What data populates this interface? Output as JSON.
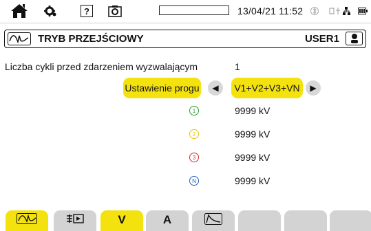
{
  "topbar": {
    "icons": [
      "home-icon",
      "settings-gear-icon",
      "help-icon",
      "camera-icon",
      "bluetooth-icon",
      "usb-network-icon",
      "battery-icon"
    ],
    "help_glyph": "?",
    "progress_fraction": 0.0,
    "datetime": "13/04/21 11:52"
  },
  "title": {
    "text": "TRYB PRZEJŚCIOWY",
    "user": "USER1",
    "icon": "transient-wave-icon"
  },
  "settings": {
    "cycles_label": "Liczba cykli przed zdarzeniem wyzwalającym",
    "cycles_value": "1",
    "threshold_button": "Ustawienie progu",
    "channel_selector": "V1+V2+V3+VN",
    "left_arrow": "◀",
    "right_arrow": "▶"
  },
  "thresholds": [
    {
      "phase": "1",
      "color": "#2a9d2a",
      "value": "9999 kV"
    },
    {
      "phase": "2",
      "color": "#e8c400",
      "value": "9999 kV"
    },
    {
      "phase": "3",
      "color": "#d62828",
      "value": "9999 kV"
    },
    {
      "phase": "N",
      "color": "#1f5fbf",
      "value": "9999 kV"
    }
  ],
  "tabs": [
    {
      "label": "",
      "icon": "transient-wave-icon",
      "active": true
    },
    {
      "label": "",
      "icon": "inrush-icon",
      "active": false
    },
    {
      "label": "V",
      "icon": "",
      "active": true
    },
    {
      "label": "A",
      "icon": "",
      "active": false
    },
    {
      "label": "",
      "icon": "decay-curve-icon",
      "active": false
    },
    {
      "label": "",
      "icon": "",
      "active": false
    },
    {
      "label": "",
      "icon": "",
      "active": false
    },
    {
      "label": "",
      "icon": "",
      "active": false
    }
  ],
  "colors": {
    "accent_yellow": "#f4e20f",
    "inactive_tab": "#d3d3d3"
  }
}
